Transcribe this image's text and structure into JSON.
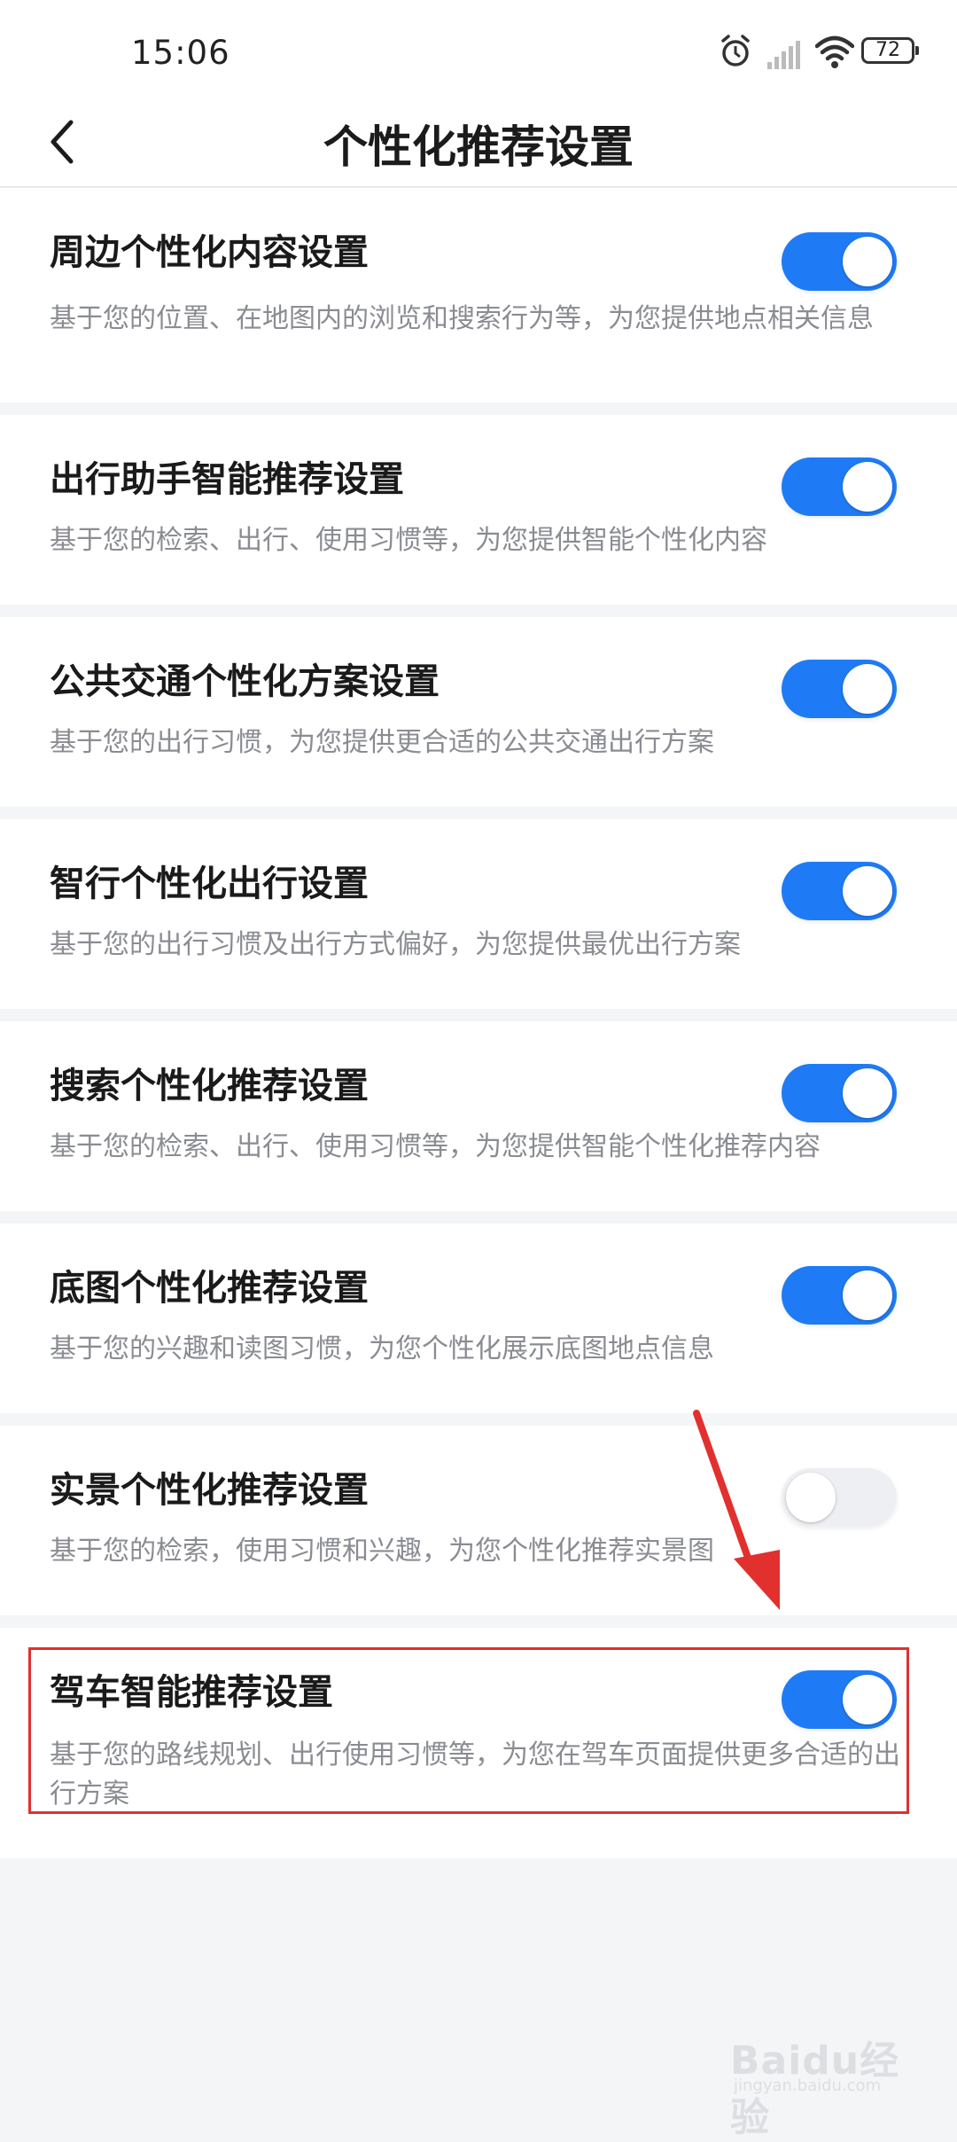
{
  "status_bar": {
    "time": "15:06",
    "battery": "72",
    "icons": [
      "alarm-icon",
      "signal-icon",
      "wifi-icon",
      "battery-icon"
    ]
  },
  "header": {
    "title": "个性化推荐设置",
    "back_icon": "chevron-left-icon"
  },
  "settings": [
    {
      "title": "周边个性化内容设置",
      "desc": "基于您的位置、在地图内的浏览和搜索行为等，为您提供地点相关信息",
      "enabled": true
    },
    {
      "title": "出行助手智能推荐设置",
      "desc": "基于您的检索、出行、使用习惯等，为您提供智能个性化内容",
      "enabled": true
    },
    {
      "title": "公共交通个性化方案设置",
      "desc": "基于您的出行习惯，为您提供更合适的公共交通出行方案",
      "enabled": true
    },
    {
      "title": "智行个性化出行设置",
      "desc": "基于您的出行习惯及出行方式偏好，为您提供最优出行方案",
      "enabled": true
    },
    {
      "title": "搜索个性化推荐设置",
      "desc": "基于您的检索、出行、使用习惯等，为您提供智能个性化推荐内容",
      "enabled": true
    },
    {
      "title": "底图个性化推荐设置",
      "desc": "基于您的兴趣和读图习惯，为您个性化展示底图地点信息",
      "enabled": true
    },
    {
      "title": "实景个性化推荐设置",
      "desc": "基于您的检索，使用习惯和兴趣，为您个性化推荐实景图",
      "enabled": false
    },
    {
      "title": "驾车智能推荐设置",
      "desc": "基于您的路线规划、出行使用习惯等，为您在驾车页面提供更多合适的出行方案",
      "enabled": true
    }
  ],
  "annotation": {
    "color": "#e2302f"
  },
  "watermark": {
    "text": "Baidu经验",
    "sub": "jingyan.baidu.com"
  },
  "colors": {
    "accent": "#1f7bf5",
    "toggle_off": "#eeeff2"
  }
}
